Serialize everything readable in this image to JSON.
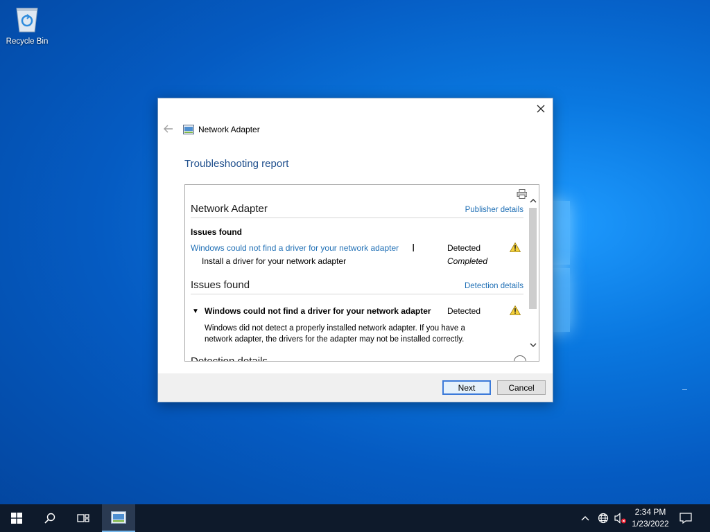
{
  "desktop": {
    "recycle_bin_label": "Recycle Bin"
  },
  "dialog": {
    "app_title": "Network Adapter",
    "report_title": "Troubleshooting report",
    "sections": {
      "adapter_title": "Network Adapter",
      "publisher_link": "Publisher details",
      "issues_found_label": "Issues found",
      "issue_link": "Windows could not find a driver for your network adapter",
      "issue_status": "Detected",
      "fix_label": "Install a driver for your network adapter",
      "fix_status": "Completed",
      "issues_title": "Issues found",
      "detection_link": "Detection details",
      "issue_bold": "Windows could not find a driver for your network adapter",
      "issue_bold_status": "Detected",
      "description": "Windows did not detect a properly installed network adapter. If you have a network adapter, the drivers for the adapter may not be installed correctly.",
      "cut_title": "Detection details"
    },
    "buttons": {
      "next": "Next",
      "cancel": "Cancel"
    }
  },
  "taskbar": {
    "time": "2:34 PM",
    "date": "1/23/2022"
  },
  "icons": {
    "close": "close-icon",
    "back": "back-arrow-icon",
    "print": "printer-icon",
    "warning": "warning-icon",
    "windows": "windows-logo-icon",
    "search": "search-icon",
    "task_view": "task-view-icon",
    "network": "network-globe-icon",
    "volume": "volume-muted-icon",
    "notifications": "notification-icon"
  },
  "colors": {
    "link": "#1f6fb5",
    "title": "#1e4e8c",
    "taskbar": "#0e1a2b"
  }
}
